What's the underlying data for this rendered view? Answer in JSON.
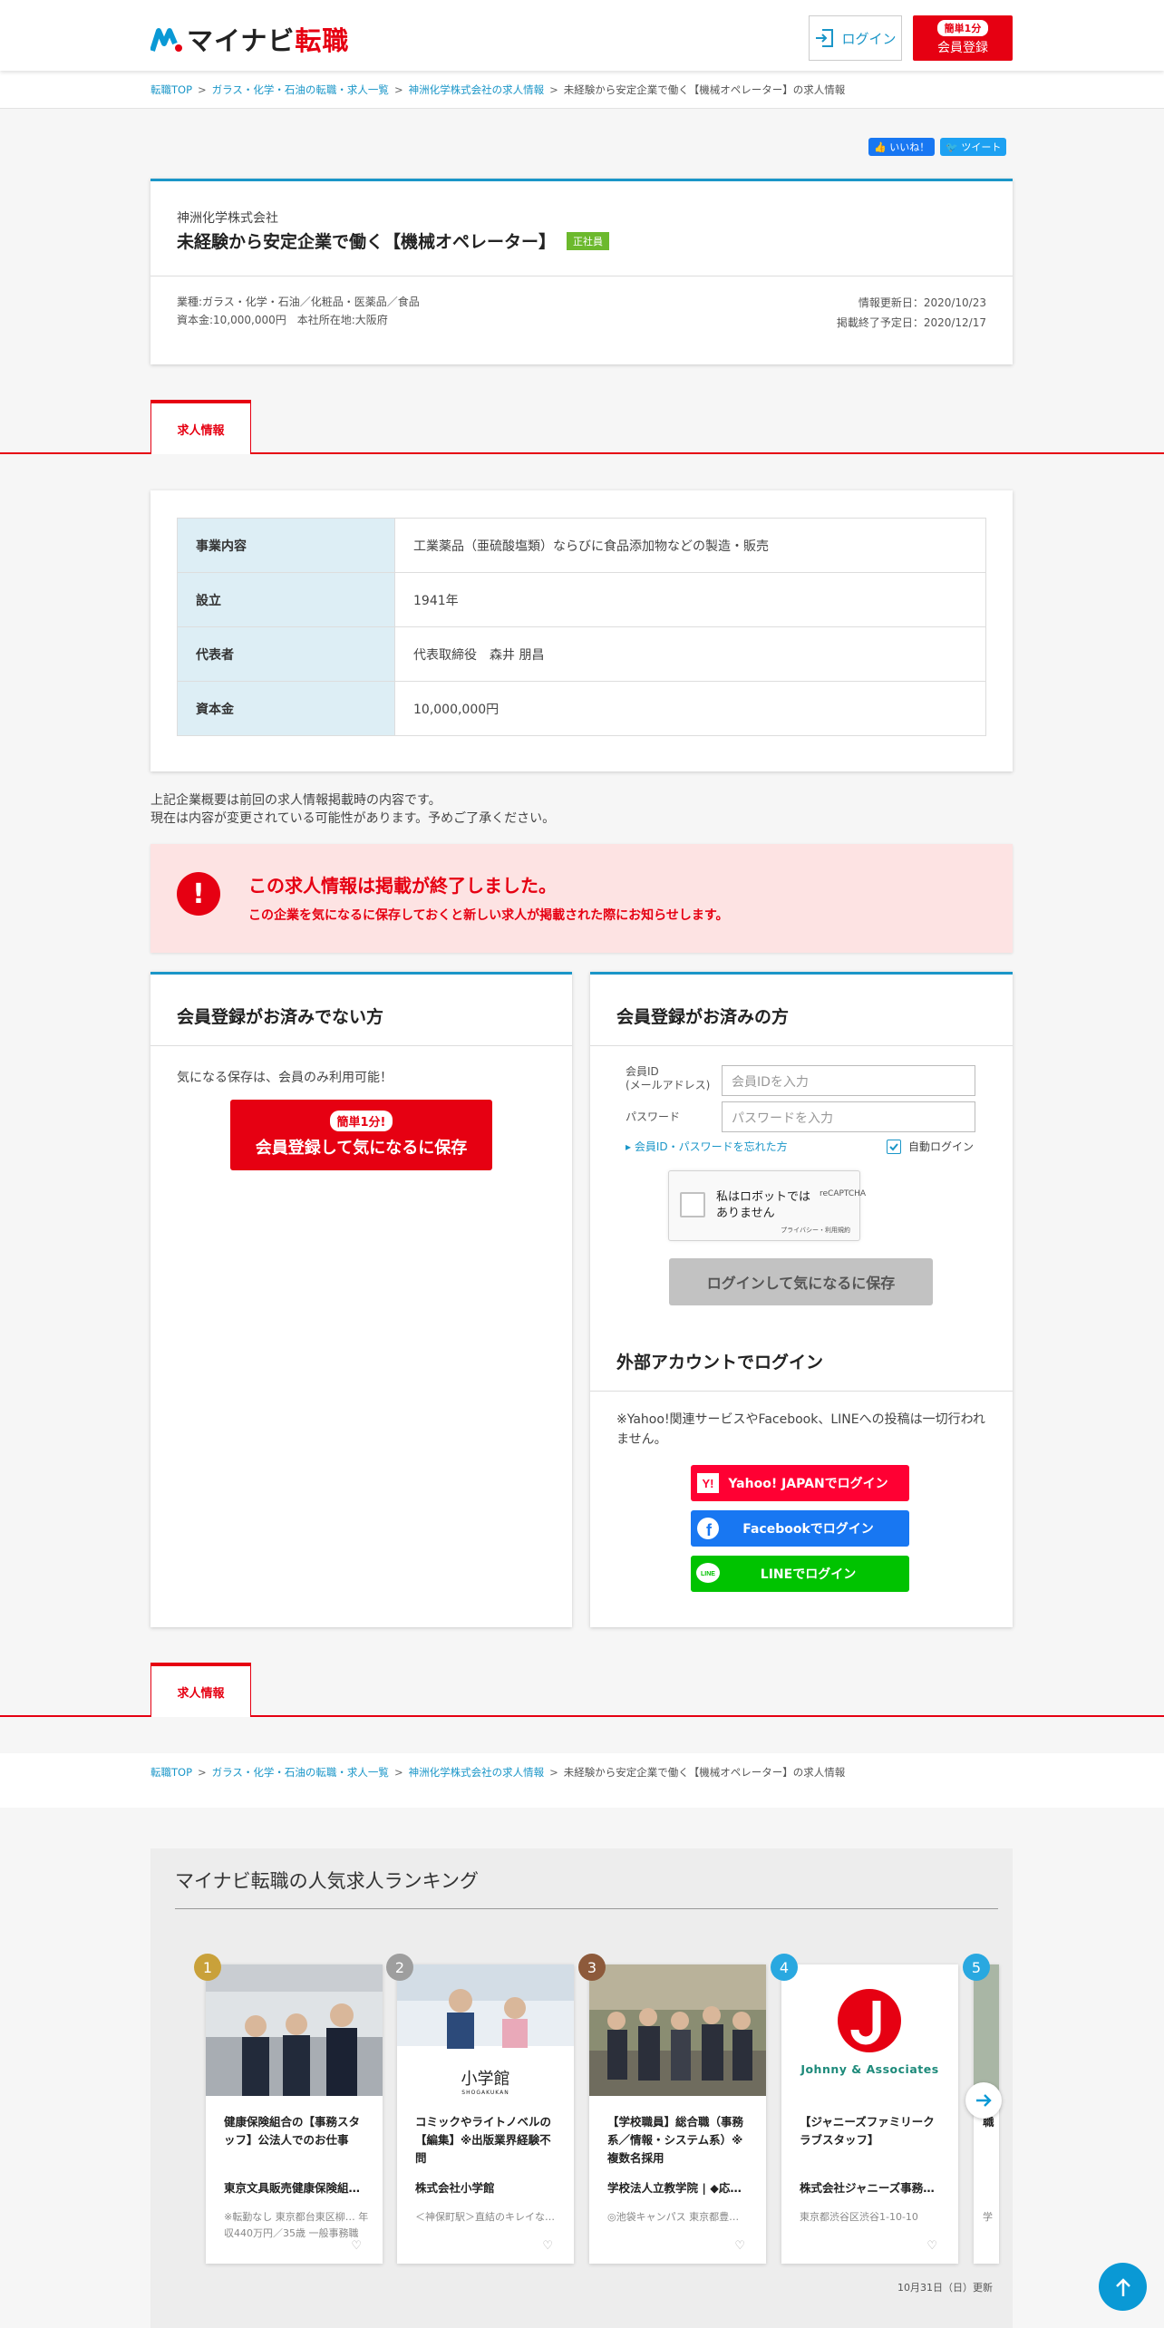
{
  "header": {
    "logo_main": "マイナビ",
    "logo_sub": "転職",
    "login_label": "ログイン",
    "register_tag": "簡単1分",
    "register_label": "会員登録"
  },
  "breadcrumb": {
    "items": [
      "転職TOP",
      "ガラス・化学・石油の転職・求人一覧",
      "神洲化学株式会社の求人情報"
    ],
    "current": "未経験から安定企業で働く【機械オペレーター】の求人情報",
    "separator": ">"
  },
  "social": {
    "like": "いいね！",
    "tweet": "ツイート"
  },
  "job": {
    "company": "神洲化学株式会社",
    "title": "未経験から安定企業で働く【機械オペレーター】",
    "employment_type": "正社員",
    "industry": "業種:ガラス・化学・石油／化粧品・医薬品／食品",
    "capital_hq": "資本金:10,000,000円　本社所在地:大阪府",
    "updated": "情報更新日：2020/10/23",
    "end_date": "掲載終了予定日：2020/12/17"
  },
  "tab_label": "求人情報",
  "company_info": {
    "rows": [
      {
        "label": "事業内容",
        "value": "工業薬品（亜硫酸塩類）ならびに食品添加物などの製造・販売"
      },
      {
        "label": "設立",
        "value": "1941年"
      },
      {
        "label": "代表者",
        "value": "代表取締役　森井 朋昌"
      },
      {
        "label": "資本金",
        "value": "10,000,000円"
      }
    ]
  },
  "note": {
    "line1": "上記企業概要は前回の求人情報掲載時の内容です。",
    "line2": "現在は内容が変更されている可能性があります。予めご了承ください。"
  },
  "alert": {
    "icon": "!",
    "heading": "この求人情報は掲載が終了しました。",
    "sub": "この企業を気になるに保存しておくと新しい求人が掲載された際にお知らせします。"
  },
  "non_member": {
    "heading": "会員登録がお済みでない方",
    "desc": "気になる保存は、会員のみ利用可能！",
    "btn_tag": "簡単1分!",
    "btn_label": "会員登録して気になるに保存"
  },
  "member": {
    "heading": "会員登録がお済みの方",
    "id_label_1": "会員ID",
    "id_label_2": "(メールアドレス)",
    "id_placeholder": "会員IDを入力",
    "pw_label": "パスワード",
    "pw_placeholder": "パスワードを入力",
    "forgot": "▸ 会員ID・パスワードを忘れた方",
    "auto_login": "自動ログイン",
    "captcha_text": "私はロボットではありません",
    "captcha_brand": "reCAPTCHA",
    "captcha_links": "プライバシー・利用規約",
    "login_save": "ログインして気になるに保存",
    "ext_heading": "外部アカウントでログイン",
    "ext_note": "※Yahoo!関連サービスやFacebook、LINEへの投稿は一切行われません。",
    "yahoo": "Yahoo! JAPANでログイン",
    "facebook": "Facebookでログイン",
    "line": "LINEでログイン",
    "yahoo_color": "#ff0033",
    "facebook_color": "#1877f2",
    "line_color": "#06c755"
  },
  "ranking": {
    "title": "マイナビ転職の人気求人ランキング",
    "updated": "10月31日（日）更新",
    "cards": [
      {
        "rank": "1",
        "rank_color": "#c9a13a",
        "title": "健康保険組合の【事務スタッフ】公法人でのお仕事",
        "company": "東京文具販売健康保険組…",
        "loc": "※転勤なし 東京都台東区柳… 年収440万円／35歳 一般事務職"
      },
      {
        "rank": "2",
        "rank_color": "#9e9e9e",
        "title": "コミックやライトノベルの【編集】※出版業界経験不問",
        "company": "株式会社小学館",
        "loc": "＜神保町駅＞直結のキレイな…",
        "photo_logo": "小学館",
        "photo_logo_sub": "SHOGAKUKAN"
      },
      {
        "rank": "3",
        "rank_color": "#8d5a3b",
        "title": "【学校職員】総合職（事務系／情報・システム系）※複数名採用",
        "company": "学校法人立教学院 | ◆応募…",
        "loc": "◎池袋キャンパス 東京都豊…"
      },
      {
        "rank": "4",
        "rank_color": "#29a8e0",
        "title": "【ジャニーズファミリークラブスタッフ】",
        "company": "株式会社ジャニーズ事務…",
        "loc": "東京都渋谷区渋谷1-10-10",
        "photo_logo": "Johnny & Associates"
      },
      {
        "rank": "5",
        "rank_color": "#29a8e0",
        "title": "職",
        "company": "",
        "loc": "学"
      }
    ]
  }
}
